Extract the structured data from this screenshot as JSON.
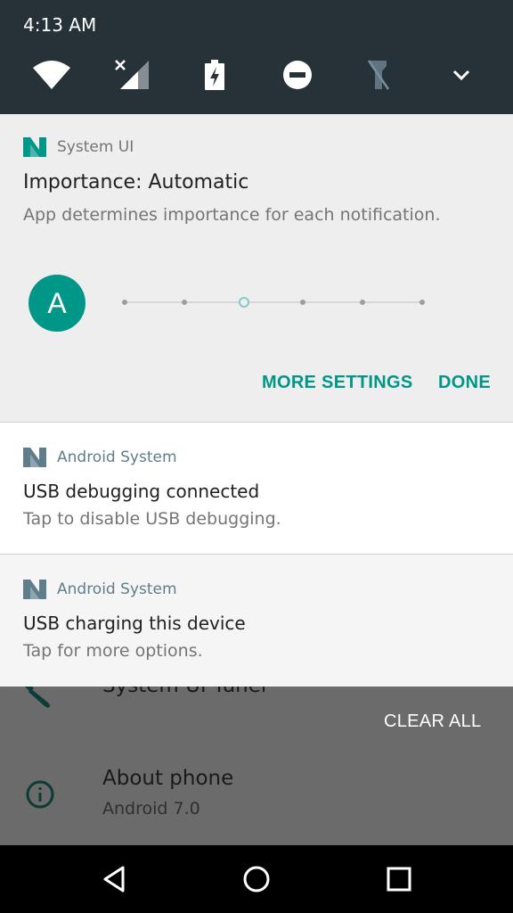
{
  "status_bar": {
    "time": "4:13 AM"
  },
  "quick_settings": {
    "icons": [
      "wifi-icon",
      "signal-no-data-icon",
      "battery-charging-icon",
      "do-not-disturb-icon",
      "flashlight-off-icon",
      "expand-chevron-icon"
    ]
  },
  "importance_card": {
    "app_name": "System UI",
    "title": "Importance: Automatic",
    "subtitle": "App determines importance for each notification.",
    "avatar_letter": "A",
    "slider": {
      "positions": 6,
      "selected_index": 2
    },
    "more_settings_label": "MORE SETTINGS",
    "done_label": "DONE"
  },
  "notifications": [
    {
      "app_name": "Android System",
      "title": "USB debugging connected",
      "text": "Tap to disable USB debugging."
    },
    {
      "app_name": "Android System",
      "title": "USB charging this device",
      "text": "Tap for more options."
    }
  ],
  "background_settings": {
    "partial_item": "System UI Tuner",
    "clear_all_label": "CLEAR ALL",
    "about": {
      "title": "About phone",
      "subtitle": "Android 7.0"
    }
  },
  "nav_bar": {
    "icons": [
      "back-icon",
      "home-icon",
      "recents-icon"
    ]
  },
  "colors": {
    "accent": "#009688",
    "header": "#263238",
    "nav": "#000000"
  }
}
